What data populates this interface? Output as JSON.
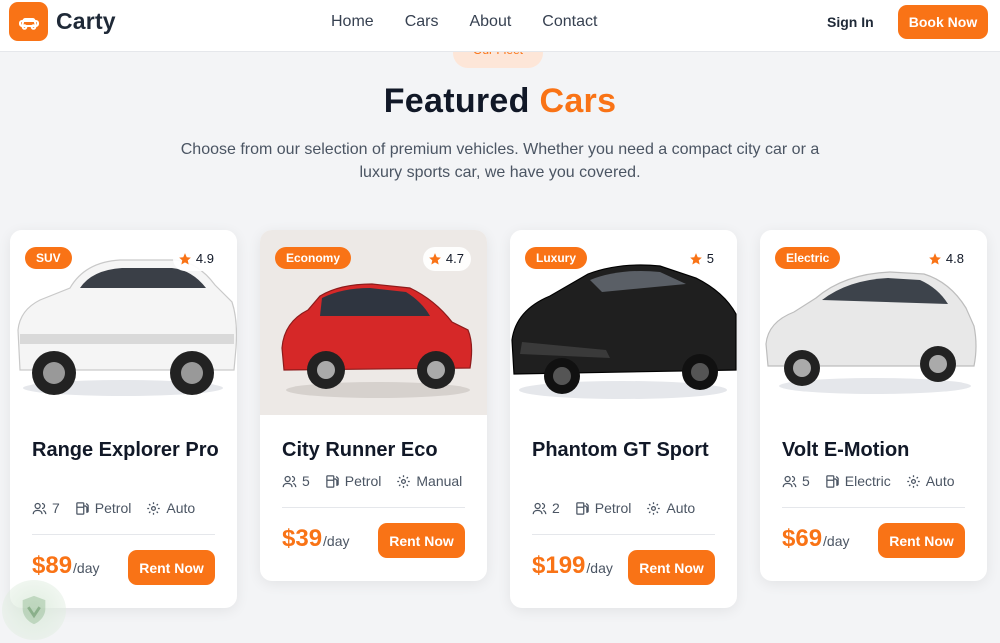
{
  "brand": {
    "name": "Carty",
    "icon": "car-icon",
    "color": "#f97316"
  },
  "nav": [
    "Home",
    "Cars",
    "About",
    "Contact"
  ],
  "header_actions": {
    "signin": "Sign In",
    "book": "Book Now"
  },
  "hero": {
    "pill": "Our Fleet",
    "heading_main": "Featured",
    "heading_accent": "Cars",
    "subtitle": "Choose from our selection of premium vehicles. Whether you need a compact city car or a luxury sports car, we have you covered."
  },
  "cars": [
    {
      "category": "SUV",
      "rating": "4.9",
      "name": "Range Explorer Pro",
      "seats": "7",
      "fuel": "Petrol",
      "transmission": "Auto",
      "price": "$89",
      "unit": "/day",
      "cta": "Rent Now",
      "car_color": "#f5f5f5"
    },
    {
      "category": "Economy",
      "rating": "4.7",
      "name": "City Runner Eco",
      "seats": "5",
      "fuel": "Petrol",
      "transmission": "Manual",
      "price": "$39",
      "unit": "/day",
      "cta": "Rent Now",
      "car_color": "#d62828"
    },
    {
      "category": "Luxury",
      "rating": "5",
      "name": "Phantom GT Sport",
      "seats": "2",
      "fuel": "Petrol",
      "transmission": "Auto",
      "price": "$199",
      "unit": "/day",
      "cta": "Rent Now",
      "car_color": "#1f1f1f"
    },
    {
      "category": "Electric",
      "rating": "4.8",
      "name": "Volt E-Motion",
      "seats": "5",
      "fuel": "Electric",
      "transmission": "Auto",
      "price": "$69",
      "unit": "/day",
      "cta": "Rent Now",
      "car_color": "#e8e8e8"
    }
  ],
  "icons": {
    "rating": "star-icon",
    "seats": "users-icon",
    "fuel": "fuel-pump-icon",
    "transmission": "gear-icon"
  }
}
